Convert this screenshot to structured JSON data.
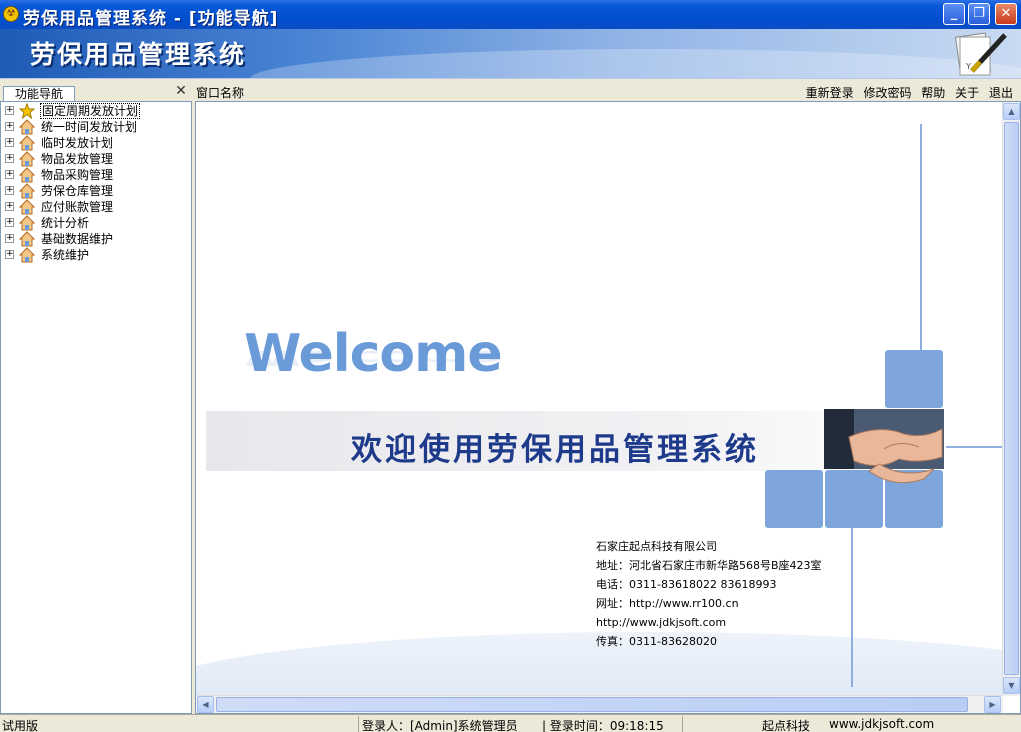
{
  "window": {
    "title": "劳保用品管理系统 - [功能导航]",
    "app_icon_glyph": "☢",
    "controls": {
      "minimize": "_",
      "maximize": "❐",
      "close": "✕"
    }
  },
  "banner": {
    "title": "劳保用品管理系统",
    "icon": "pen-icon"
  },
  "toolbar": {
    "nav_tab": "功能导航",
    "window_name_label": "窗口名称",
    "links": [
      "重新登录",
      "修改密码",
      "帮助",
      "关于",
      "退出"
    ]
  },
  "tree": {
    "items": [
      {
        "label": "固定周期发放计划",
        "icon": "star-icon",
        "selected": true
      },
      {
        "label": "统一时间发放计划",
        "icon": "home-icon"
      },
      {
        "label": "临时发放计划",
        "icon": "home-icon"
      },
      {
        "label": "物品发放管理",
        "icon": "home-icon"
      },
      {
        "label": "物品采购管理",
        "icon": "home-icon"
      },
      {
        "label": "劳保仓库管理",
        "icon": "home-icon"
      },
      {
        "label": "应付账款管理",
        "icon": "home-icon"
      },
      {
        "label": "统计分析",
        "icon": "home-icon"
      },
      {
        "label": "基础数据维护",
        "icon": "home-icon"
      },
      {
        "label": "系统维护",
        "icon": "home-icon"
      }
    ]
  },
  "welcome": {
    "word": "Welcome",
    "title_cn": "欢迎使用劳保用品管理系统",
    "company": {
      "name": "石家庄起点科技有限公司",
      "address": "地址：河北省石家庄市新华路568号B座423室",
      "phone": "电话：0311-83618022  83618993",
      "website1": "网址：http://www.rr100.cn",
      "website2": "http://www.jdkjsoft.com",
      "fax": "传真：0311-83628020"
    }
  },
  "status": {
    "edition": "试用版",
    "user": "登录人：[Admin]系统管理员",
    "login_time": "| 登录时间：09:18:15",
    "company": "起点科技",
    "website": "www.jdkjsoft.com"
  },
  "colors": {
    "accent": "#0a58d8",
    "banner": "#4a84d4",
    "square": "#7ea6dc",
    "title_cn": "#1e3a8a"
  }
}
